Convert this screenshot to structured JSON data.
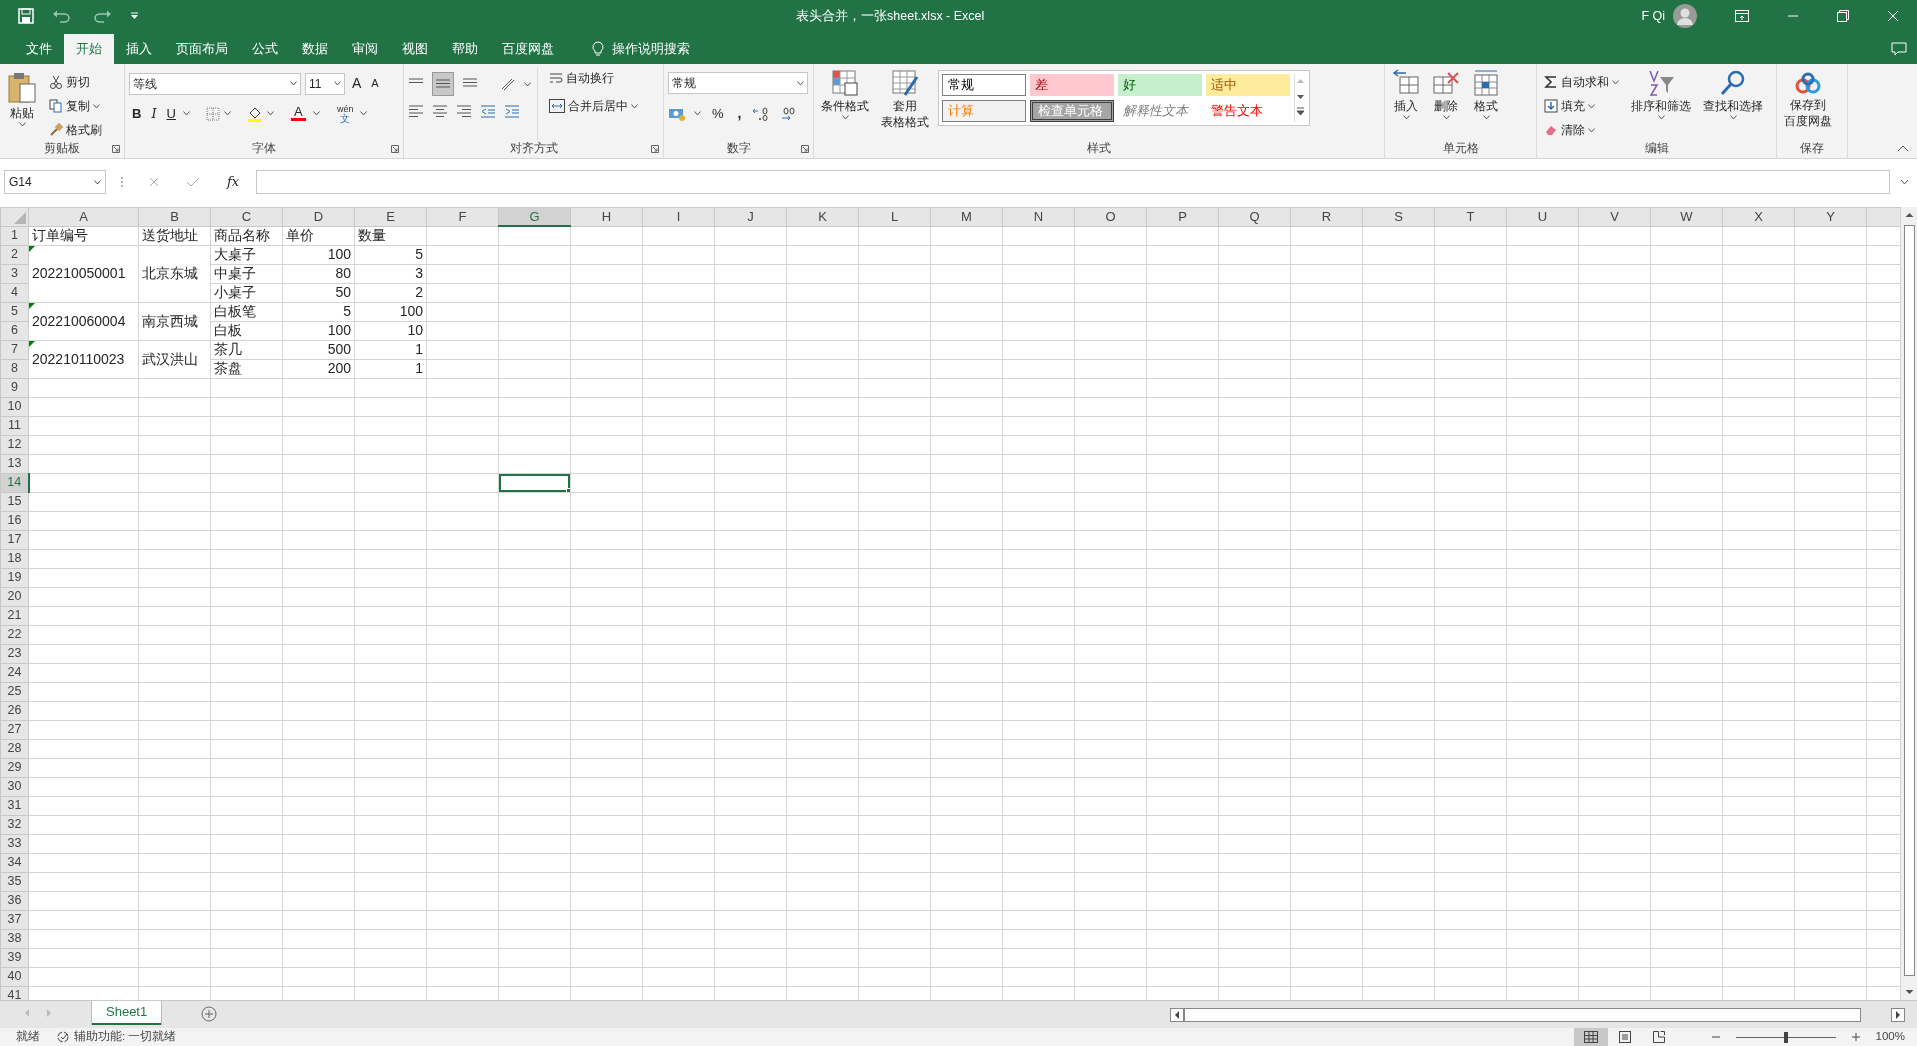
{
  "window": {
    "title": "表头合并，一张sheet.xlsx  -  Excel",
    "user": "F Qi"
  },
  "ribbon_tabs": [
    {
      "label": "文件",
      "selected": false
    },
    {
      "label": "开始",
      "selected": true
    },
    {
      "label": "插入",
      "selected": false
    },
    {
      "label": "页面布局",
      "selected": false
    },
    {
      "label": "公式",
      "selected": false
    },
    {
      "label": "数据",
      "selected": false
    },
    {
      "label": "审阅",
      "selected": false
    },
    {
      "label": "视图",
      "selected": false
    },
    {
      "label": "帮助",
      "selected": false
    },
    {
      "label": "百度网盘",
      "selected": false
    }
  ],
  "tell_me": {
    "label": "操作说明搜索"
  },
  "ribbon_groups": [
    {
      "kind": "clipboard",
      "label": "剪贴板",
      "paste": "粘贴",
      "items": [
        {
          "kind": "cut",
          "label": "剪切"
        },
        {
          "kind": "copy",
          "label": "复制"
        },
        {
          "kind": "painter",
          "label": "格式刷"
        }
      ]
    },
    {
      "kind": "font",
      "label": "字体",
      "font": "等线",
      "size": "11",
      "grow": "A",
      "shrink": "A",
      "styles": [
        "B",
        "I",
        "U"
      ],
      "font_color": "A",
      "phonetic": "wén",
      "phonetic_sub": "文"
    },
    {
      "kind": "alignment",
      "label": "对齐方式",
      "wrap": "自动换行",
      "merge": "合并后居中"
    },
    {
      "kind": "number",
      "label": "数字",
      "format": "常规",
      "percent": "%",
      "comma": ","
    },
    {
      "kind": "styles",
      "label": "样式",
      "conditional": "条件格式",
      "table": [
        "套用",
        "表格格式"
      ],
      "cells": [
        {
          "kind": "normal",
          "label": "常规"
        },
        {
          "kind": "bad",
          "label": "差"
        },
        {
          "kind": "good",
          "label": "好"
        },
        {
          "kind": "neutral",
          "label": "适中"
        },
        {
          "kind": "calc",
          "label": "计算"
        },
        {
          "kind": "check",
          "label": "检查单元格"
        },
        {
          "kind": "explanatory",
          "label": "解释性文本"
        },
        {
          "kind": "warning",
          "label": "警告文本"
        }
      ]
    },
    {
      "kind": "cells",
      "label": "单元格",
      "items": [
        {
          "kind": "insert",
          "label": "插入"
        },
        {
          "kind": "delete",
          "label": "删除"
        },
        {
          "kind": "format",
          "label": "格式"
        }
      ]
    },
    {
      "kind": "editing",
      "label": "编辑",
      "items": [
        {
          "kind": "sum",
          "label": "自动求和"
        },
        {
          "kind": "fill",
          "label": "填充"
        },
        {
          "kind": "clear",
          "label": "清除"
        }
      ],
      "sort": "排序和筛选",
      "find": "查找和选择"
    },
    {
      "kind": "save",
      "label": "保存",
      "button": [
        "保存到",
        "百度网盘"
      ]
    }
  ],
  "formula_bar": {
    "name_box": "G14",
    "fx": "fx"
  },
  "header_row": [
    "订单编号",
    "送货地址",
    "商品名称",
    "单价",
    "数量"
  ],
  "orders": [
    {
      "order_no": "202210050001",
      "address": "北京东城",
      "error_flag": true,
      "items": [
        {
          "name": "大桌子",
          "price": "100",
          "qty": "5"
        },
        {
          "name": "中桌子",
          "price": "80",
          "qty": "3"
        },
        {
          "name": "小桌子",
          "price": "50",
          "qty": "2"
        }
      ]
    },
    {
      "order_no": "202210060004",
      "address": "南京西城",
      "error_flag": true,
      "items": [
        {
          "name": "白板笔",
          "price": "5",
          "qty": "100"
        },
        {
          "name": "白板",
          "price": "100",
          "qty": "10"
        }
      ]
    },
    {
      "order_no": "202210110023",
      "address": "武汉洪山",
      "error_flag": true,
      "items": [
        {
          "name": "茶几",
          "price": "500",
          "qty": "1"
        },
        {
          "name": "茶盘",
          "price": "200",
          "qty": "1"
        }
      ]
    }
  ],
  "columns": [
    {
      "label": "A",
      "selected": false
    },
    {
      "label": "B",
      "selected": false
    },
    {
      "label": "C",
      "selected": false
    },
    {
      "label": "D",
      "selected": false
    },
    {
      "label": "E",
      "selected": false
    },
    {
      "label": "F",
      "selected": false
    },
    {
      "label": "G",
      "selected": true
    },
    {
      "label": "H",
      "selected": false
    },
    {
      "label": "I",
      "selected": false
    },
    {
      "label": "J",
      "selected": false
    },
    {
      "label": "K",
      "selected": false
    },
    {
      "label": "L",
      "selected": false
    },
    {
      "label": "M",
      "selected": false
    },
    {
      "label": "N",
      "selected": false
    },
    {
      "label": "O",
      "selected": false
    },
    {
      "label": "P",
      "selected": false
    },
    {
      "label": "Q",
      "selected": false
    },
    {
      "label": "R",
      "selected": false
    },
    {
      "label": "S",
      "selected": false
    },
    {
      "label": "T",
      "selected": false
    },
    {
      "label": "U",
      "selected": false
    },
    {
      "label": "V",
      "selected": false
    },
    {
      "label": "W",
      "selected": false
    },
    {
      "label": "X",
      "selected": false
    },
    {
      "label": "Y",
      "selected": false
    }
  ],
  "row_headers": [
    {
      "label": "1",
      "selected": false
    },
    {
      "label": "2",
      "selected": false
    },
    {
      "label": "3",
      "selected": false
    },
    {
      "label": "4",
      "selected": false
    },
    {
      "label": "5",
      "selected": false
    },
    {
      "label": "6",
      "selected": false
    },
    {
      "label": "7",
      "selected": false
    },
    {
      "label": "8",
      "selected": false
    },
    {
      "label": "9",
      "selected": false
    },
    {
      "label": "10",
      "selected": false
    },
    {
      "label": "11",
      "selected": false
    },
    {
      "label": "12",
      "selected": false
    },
    {
      "label": "13",
      "selected": false
    },
    {
      "label": "14",
      "selected": true
    },
    {
      "label": "15",
      "selected": false
    },
    {
      "label": "16",
      "selected": false
    },
    {
      "label": "17",
      "selected": false
    },
    {
      "label": "18",
      "selected": false
    },
    {
      "label": "19",
      "selected": false
    },
    {
      "label": "20",
      "selected": false
    },
    {
      "label": "21",
      "selected": false
    },
    {
      "label": "22",
      "selected": false
    },
    {
      "label": "23",
      "selected": false
    },
    {
      "label": "24",
      "selected": false
    },
    {
      "label": "25",
      "selected": false
    },
    {
      "label": "26",
      "selected": false
    },
    {
      "label": "27",
      "selected": false
    },
    {
      "label": "28",
      "selected": false
    },
    {
      "label": "29",
      "selected": false
    },
    {
      "label": "30",
      "selected": false
    },
    {
      "label": "31",
      "selected": false
    },
    {
      "label": "32",
      "selected": false
    },
    {
      "label": "33",
      "selected": false
    },
    {
      "label": "34",
      "selected": false
    },
    {
      "label": "35",
      "selected": false
    },
    {
      "label": "36",
      "selected": false
    },
    {
      "label": "37",
      "selected": false
    },
    {
      "label": "38",
      "selected": false
    },
    {
      "label": "39",
      "selected": false
    },
    {
      "label": "40",
      "selected": false
    },
    {
      "label": "41",
      "selected": false
    }
  ],
  "sheet_tabs": [
    {
      "label": "Sheet1",
      "selected": true
    }
  ],
  "status_bar": {
    "ready": "就绪",
    "accessibility": "辅助功能: 一切就绪",
    "views": [
      {
        "kind": "normal",
        "selected": true
      },
      {
        "kind": "page_layout",
        "selected": false
      },
      {
        "kind": "page_break",
        "selected": false
      }
    ],
    "zoom": {
      "level": 0.5,
      "label": "100%"
    }
  }
}
